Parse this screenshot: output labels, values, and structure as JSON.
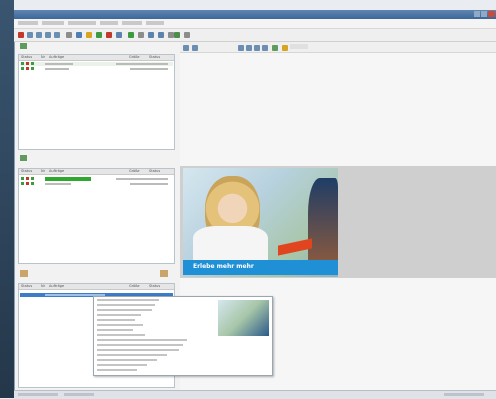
{
  "colors": {
    "accent": "#3d6797",
    "progress": "#2fa82f",
    "ad_banner": "#1f8fd6"
  },
  "ad": {
    "headline": "Erlebe mehr mehr"
  },
  "panels": {
    "top": {
      "header": [
        "Status",
        "Nr",
        "Aufträge",
        "Größe",
        "Status"
      ]
    },
    "middle": {
      "header": [
        "Status",
        "Nr",
        "Aufträge",
        "Größe",
        "Status"
      ]
    },
    "bottom": {
      "header": [
        "Status",
        "Nr",
        "Aufträge",
        "Größe",
        "Status"
      ]
    }
  }
}
